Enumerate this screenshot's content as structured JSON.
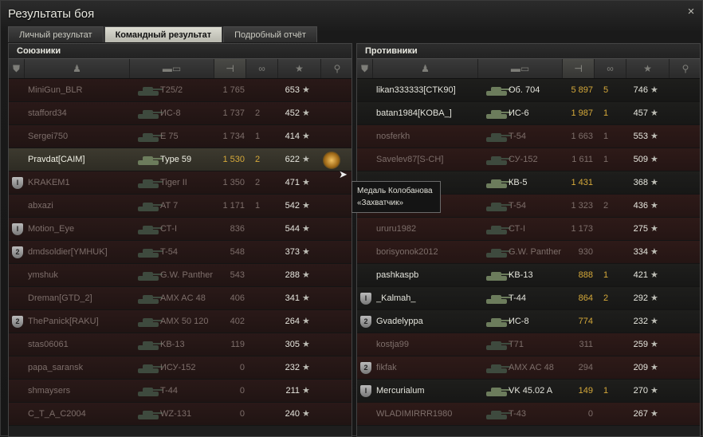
{
  "window": {
    "title": "Результаты боя",
    "close_label": "×"
  },
  "tabs": [
    {
      "label": "Личный результат",
      "active": false
    },
    {
      "label": "Командный результат",
      "active": true
    },
    {
      "label": "Подробный отчёт",
      "active": false
    }
  ],
  "allies": {
    "title": "Союзники",
    "rows": [
      {
        "name": "MiniGun_BLR",
        "tank": "T25/2",
        "damage": "1 765",
        "kills": "",
        "xp": "653",
        "state": "dead",
        "badge": ""
      },
      {
        "name": "stafford34",
        "tank": "ИС-8",
        "damage": "1 737",
        "kills": "2",
        "xp": "452",
        "state": "dead",
        "badge": ""
      },
      {
        "name": "Sergei750",
        "tank": "E 75",
        "damage": "1 734",
        "kills": "1",
        "xp": "414",
        "state": "dead",
        "badge": ""
      },
      {
        "name": "Pravdat[CAIM]",
        "tank": "Type 59",
        "damage": "1 530",
        "kills": "2",
        "xp": "622",
        "state": "mine",
        "badge": "",
        "medal": true
      },
      {
        "name": "KRAKEM1",
        "tank": "Tiger II",
        "damage": "1 350",
        "kills": "2",
        "xp": "471",
        "state": "dead",
        "badge": "I"
      },
      {
        "name": "abxazi",
        "tank": "AT 7",
        "damage": "1 171",
        "kills": "1",
        "xp": "542",
        "state": "dead",
        "badge": ""
      },
      {
        "name": "Motion_Eye",
        "tank": "СТ-I",
        "damage": "836",
        "kills": "",
        "xp": "544",
        "state": "dead",
        "badge": "I"
      },
      {
        "name": "dmdsoldier[YMHUK]",
        "tank": "T-54",
        "damage": "548",
        "kills": "",
        "xp": "373",
        "state": "dead",
        "badge": "2"
      },
      {
        "name": "ymshuk",
        "tank": "G.W. Panther",
        "damage": "543",
        "kills": "",
        "xp": "288",
        "state": "dead",
        "badge": ""
      },
      {
        "name": "Dreman[GTD_2]",
        "tank": "AMX AC 48",
        "damage": "406",
        "kills": "",
        "xp": "341",
        "state": "dead",
        "badge": ""
      },
      {
        "name": "ThePanick[RAKU]",
        "tank": "AMX 50 120",
        "damage": "402",
        "kills": "",
        "xp": "264",
        "state": "dead",
        "badge": "2"
      },
      {
        "name": "stas06061",
        "tank": "KB-13",
        "damage": "119",
        "kills": "",
        "xp": "305",
        "state": "dead",
        "badge": ""
      },
      {
        "name": "papa_saransk",
        "tank": "ИСУ-152",
        "damage": "0",
        "kills": "",
        "xp": "232",
        "state": "dead",
        "badge": ""
      },
      {
        "name": "shmaysers",
        "tank": "T-44",
        "damage": "0",
        "kills": "",
        "xp": "211",
        "state": "dead",
        "badge": ""
      },
      {
        "name": "C_T_A_C2004",
        "tank": "WZ-131",
        "damage": "0",
        "kills": "",
        "xp": "240",
        "state": "dead",
        "badge": ""
      }
    ]
  },
  "enemies": {
    "title": "Противники",
    "rows": [
      {
        "name": "likan333333[CTK90]",
        "tank": "Об. 704",
        "damage": "5 897",
        "kills": "5",
        "xp": "746",
        "state": "alive",
        "badge": ""
      },
      {
        "name": "batan1984[KOBA_]",
        "tank": "ИС-6",
        "damage": "1 987",
        "kills": "1",
        "xp": "457",
        "state": "alive",
        "badge": ""
      },
      {
        "name": "nosferkh",
        "tank": "T-54",
        "damage": "1 663",
        "kills": "1",
        "xp": "553",
        "state": "dead",
        "badge": ""
      },
      {
        "name": "Savelev87[S-CH]",
        "tank": "СУ-152",
        "damage": "1 611",
        "kills": "1",
        "xp": "509",
        "state": "dead",
        "badge": ""
      },
      {
        "name": "",
        "tank": "КВ-5",
        "damage": "1 431",
        "kills": "",
        "xp": "368",
        "state": "alive",
        "badge": ""
      },
      {
        "name": "",
        "tank": "T-54",
        "damage": "1 323",
        "kills": "2",
        "xp": "436",
        "state": "dead",
        "badge": ""
      },
      {
        "name": "ururu1982",
        "tank": "СТ-I",
        "damage": "1 173",
        "kills": "",
        "xp": "275",
        "state": "dead",
        "badge": ""
      },
      {
        "name": "borisyonok2012",
        "tank": "G.W. Panther",
        "damage": "930",
        "kills": "",
        "xp": "334",
        "state": "dead",
        "badge": ""
      },
      {
        "name": "pashkaspb",
        "tank": "KB-13",
        "damage": "888",
        "kills": "1",
        "xp": "421",
        "state": "alive",
        "badge": ""
      },
      {
        "name": "_Kalmah_",
        "tank": "T-44",
        "damage": "864",
        "kills": "2",
        "xp": "292",
        "state": "alive",
        "badge": "I"
      },
      {
        "name": "Gvadelyppa",
        "tank": "ИС-8",
        "damage": "774",
        "kills": "",
        "xp": "232",
        "state": "alive",
        "badge": "2"
      },
      {
        "name": "kostja99",
        "tank": "T71",
        "damage": "311",
        "kills": "",
        "xp": "259",
        "state": "dead",
        "badge": ""
      },
      {
        "name": "fikfak",
        "tank": "AMX AC 48",
        "damage": "294",
        "kills": "",
        "xp": "209",
        "state": "dead",
        "badge": "2"
      },
      {
        "name": "Mercurialum",
        "tank": "VK 45.02 A",
        "damage": "149",
        "kills": "1",
        "xp": "270",
        "state": "alive",
        "badge": "I"
      },
      {
        "name": "WLADIMIRRR1980",
        "tank": "T-43",
        "damage": "0",
        "kills": "",
        "xp": "267",
        "state": "dead",
        "badge": ""
      }
    ]
  },
  "columns": [
    "squad-icon",
    "player-icon",
    "tank-icon",
    "damage-icon",
    "kills-icon",
    "xp-star-icon",
    "medal-icon"
  ],
  "star_glyph": "★",
  "tooltip": {
    "line1": "Медаль Колобанова",
    "line2": "«Захватчик»"
  }
}
